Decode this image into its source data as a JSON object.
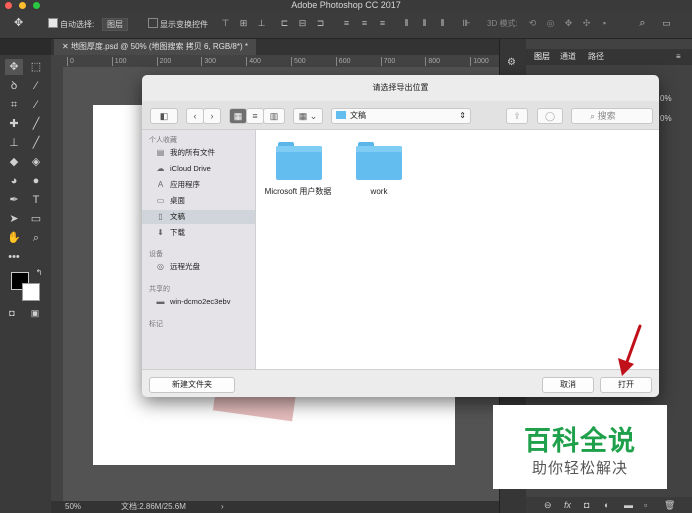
{
  "app": {
    "title": "Adobe Photoshop CC 2017"
  },
  "options_bar": {
    "move_icon": "✥",
    "auto_select_label": "自动选择:",
    "auto_select_value": "图层",
    "show_transform_label": "显示变换控件",
    "mode_3d_label": "3D 模式:"
  },
  "document": {
    "tab_label": "地图厚度.psd @ 50% (地图搜索 拷贝 6, RGB/8*) *",
    "zoom": "50%",
    "doc_size": "文档:2.86M/25.6M",
    "ruler_ticks": [
      "0",
      "100",
      "200",
      "300",
      "400",
      "500",
      "600",
      "700",
      "800",
      "1000"
    ]
  },
  "panels": {
    "tabs": [
      "图层",
      "通道",
      "路径"
    ],
    "opacity_1": "0%",
    "opacity_2": "0%"
  },
  "dialog": {
    "title": "请选择导出位置",
    "location": "文稿",
    "search_placeholder": "搜索",
    "sidebar": {
      "favorites_header": "个人收藏",
      "favorites": [
        {
          "icon": "all-files-icon",
          "glyph": "▤",
          "label": "我的所有文件"
        },
        {
          "icon": "icloud-icon",
          "glyph": "☁",
          "label": "iCloud Drive"
        },
        {
          "icon": "applications-icon",
          "glyph": "A",
          "label": "应用程序"
        },
        {
          "icon": "desktop-icon",
          "glyph": "▭",
          "label": "桌面"
        },
        {
          "icon": "documents-icon",
          "glyph": "▯",
          "label": "文稿"
        },
        {
          "icon": "downloads-icon",
          "glyph": "⬇",
          "label": "下载"
        }
      ],
      "devices_header": "设备",
      "devices": [
        {
          "icon": "remote-disc-icon",
          "glyph": "◎",
          "label": "远程光盘"
        }
      ],
      "shared_header": "共享的",
      "shared": [
        {
          "icon": "computer-icon",
          "glyph": "▬",
          "label": "win-dcmo2ec3ebv"
        }
      ],
      "tags_header": "标记"
    },
    "folders": [
      {
        "name": "Microsoft 用户数据"
      },
      {
        "name": "work"
      }
    ],
    "new_folder_label": "新建文件夹",
    "cancel_label": "取消",
    "open_label": "打开"
  },
  "watermark": {
    "title": "百科全说",
    "subtitle": "助你轻松解决"
  },
  "colors": {
    "accent_folder": "#63bdef",
    "annotation_arrow": "#c0101a",
    "watermark_green": "#1fa04a"
  }
}
